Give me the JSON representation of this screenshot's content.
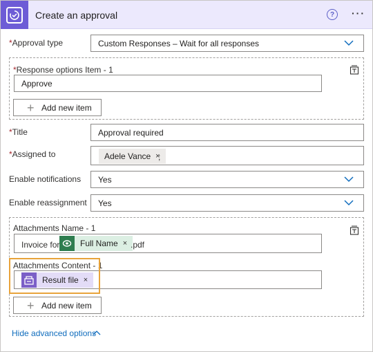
{
  "header": {
    "title": "Create an approval",
    "help_icon": "?",
    "more_icon": "···"
  },
  "approval_type": {
    "label": "Approval type",
    "required": "*",
    "value": "Custom Responses – Wait for all responses"
  },
  "response_options": {
    "label": "Response options Item - 1",
    "required": "*",
    "value": "Approve",
    "add_label": "Add new item"
  },
  "title_field": {
    "label": "Title",
    "required": "*",
    "value": "Approval required"
  },
  "assigned_to": {
    "label": "Assigned to",
    "required": "*",
    "token": "Adele Vance",
    "separator": ";"
  },
  "enable_notifications": {
    "label": "Enable notifications",
    "value": "Yes"
  },
  "enable_reassignment": {
    "label": "Enable reassignment",
    "value": "Yes"
  },
  "attachments_name": {
    "label": "Attachments Name - 1",
    "prefix": "Invoice for",
    "token": "Full Name",
    "suffix": ".pdf"
  },
  "attachments_content": {
    "label": "Attachments Content - 1",
    "token": "Result file",
    "add_label": "Add new item"
  },
  "footer": {
    "link": "Hide advanced options"
  },
  "token_close": "×",
  "colors": {
    "brand": "#6d5cd6",
    "header_bg": "#ece9fd",
    "dataverse_green": "#2e7d4f",
    "token_purple_bg": "#e3dcf7",
    "highlight": "#e8a33a",
    "link": "#0f6cbd",
    "required": "#a4262c"
  },
  "icons": {
    "app": "approval-icon",
    "dataverse": "dataverse-icon",
    "file": "file-content-icon",
    "remove_section": "remove-item-icon"
  }
}
